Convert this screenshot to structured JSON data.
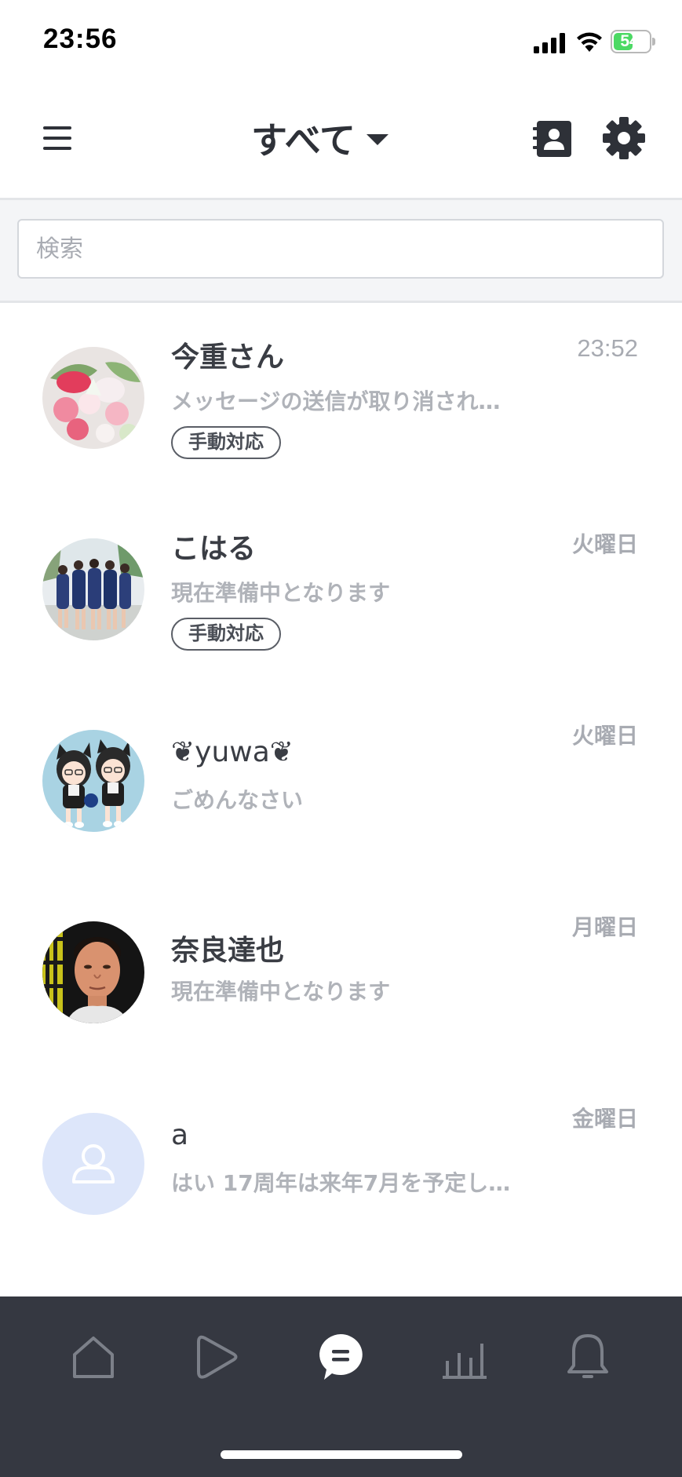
{
  "status_bar": {
    "time": "23:56",
    "battery_percent": "54",
    "battery_level": 0.54,
    "battery_color": "#4cd964"
  },
  "header": {
    "title": "すべて",
    "menu_icon": "hamburger-icon",
    "contacts_icon": "contact-book-icon",
    "settings_icon": "gear-icon"
  },
  "search": {
    "placeholder": "検索"
  },
  "chats": [
    {
      "name": "今重さん",
      "message": "メッセージの送信が取り消され…",
      "time": "23:52",
      "tag": "手動対応",
      "avatar": "flower-bouquet-photo"
    },
    {
      "name": "こはる",
      "message": "現在準備中となります",
      "time": "火曜日",
      "tag": "手動対応",
      "avatar": "group-photo"
    },
    {
      "name": "❦yuwa❦",
      "message": "ごめんなさい",
      "time": "火曜日",
      "avatar": "anime-duo-illustration"
    },
    {
      "name": "奈良達也",
      "message": "現在準備中となります",
      "time": "月曜日",
      "avatar": "portrait-photo"
    },
    {
      "name": "a",
      "message": "はい 17周年は来年7月を予定し…",
      "time": "金曜日",
      "avatar": "default-user-icon"
    }
  ],
  "bottom_nav": [
    {
      "icon": "home-icon",
      "active": false
    },
    {
      "icon": "play-icon",
      "active": false
    },
    {
      "icon": "chat-icon",
      "active": true
    },
    {
      "icon": "bar-chart-icon",
      "active": false
    },
    {
      "icon": "bell-icon",
      "active": false
    }
  ],
  "colors": {
    "nav_background": "#353841",
    "nav_icon_inactive": "#7c8089",
    "nav_icon_active": "#ffffff",
    "text_primary": "#3a3d44",
    "text_secondary": "#b0b3b9",
    "default_avatar_bg": "#dde6fa"
  }
}
